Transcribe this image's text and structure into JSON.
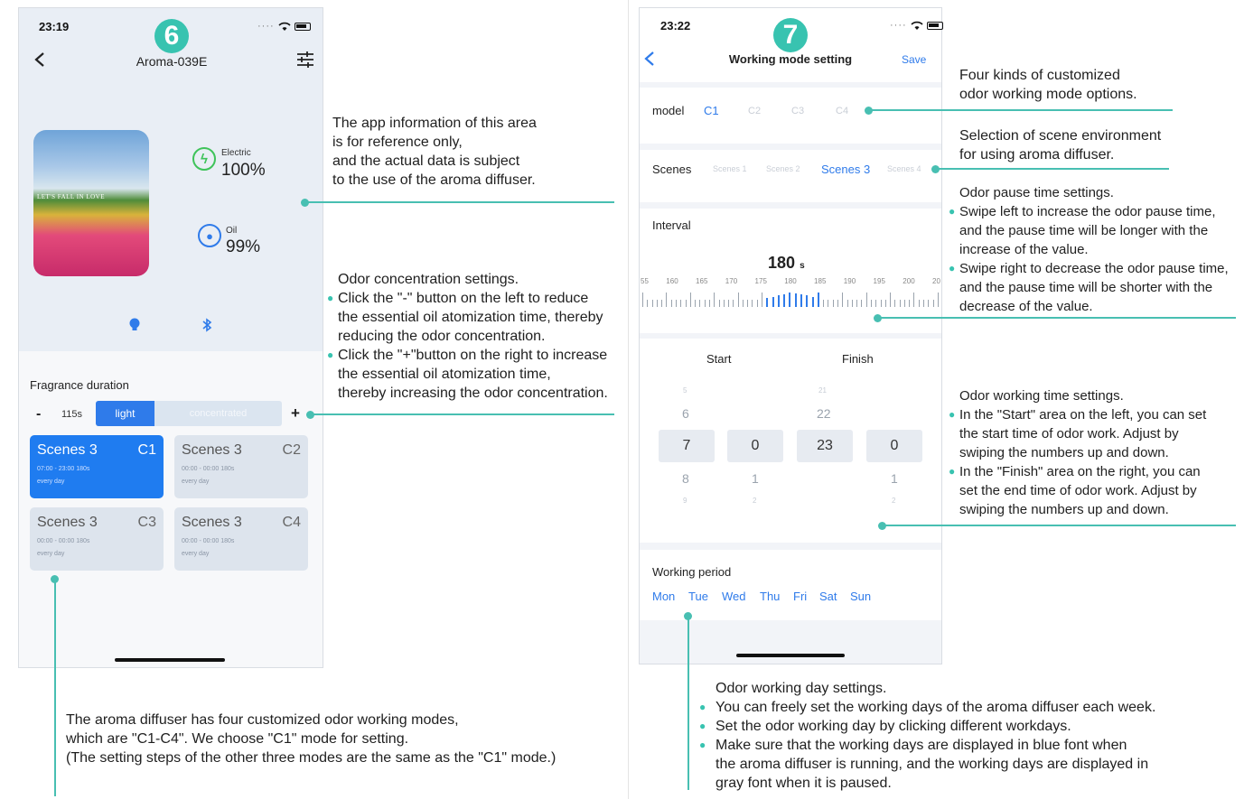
{
  "phone1": {
    "step": "6",
    "status_time": "23:19",
    "title": "Aroma-039E",
    "photo_text": "LET'S FALL IN LOVE",
    "electric_label": "Electric",
    "electric_value": "100%",
    "oil_label": "Oil",
    "oil_value": "99%",
    "fragrance_title": "Fragrance duration",
    "minus": "-",
    "duration_value": "115s",
    "seg_light": "light",
    "seg_concentrated": "concentrated",
    "plus": "+",
    "cards": [
      {
        "name": "Scenes 3",
        "code": "C1",
        "time": "07:00 - 23:00   180s",
        "days": "every day"
      },
      {
        "name": "Scenes 3",
        "code": "C2",
        "time": "00:00 - 00:00   180s",
        "days": "every day"
      },
      {
        "name": "Scenes 3",
        "code": "C3",
        "time": "00:00 - 00:00   180s",
        "days": "every day"
      },
      {
        "name": "Scenes 3",
        "code": "C4",
        "time": "00:00 - 00:00   180s",
        "days": "every day"
      }
    ]
  },
  "phone2": {
    "step": "7",
    "status_time": "23:22",
    "title": "Working mode setting",
    "save": "Save",
    "model_label": "model",
    "models": [
      "C1",
      "C2",
      "C3",
      "C4"
    ],
    "scenes_label": "Scenes",
    "scenes": [
      "Scenes 1",
      "Scenes 2",
      "Scenes 3",
      "Scenes 4"
    ],
    "interval_label": "Interval",
    "interval_value": "180",
    "interval_unit": "s",
    "ticks": [
      "55",
      "160",
      "165",
      "170",
      "175",
      "180",
      "185",
      "190",
      "195",
      "200",
      "20"
    ],
    "start_label": "Start",
    "finish_label": "Finish",
    "wheel": {
      "row_far_top": [
        "5",
        "21"
      ],
      "row_top": [
        "6",
        "22"
      ],
      "row_sel": [
        "7",
        "0",
        "23",
        "0"
      ],
      "row_bottom": [
        "8",
        "1",
        "1"
      ],
      "row_far_bottom": [
        "9",
        "2",
        "2"
      ]
    },
    "working_period_label": "Working period",
    "days": [
      "Mon",
      "Tue",
      "Wed",
      "Thu",
      "Fri",
      "Sat",
      "Sun"
    ]
  },
  "callouts": {
    "app_info": [
      "The app information of this area",
      "is for reference only,",
      "and the actual data is subject",
      "to the use of the aroma diffuser."
    ],
    "odor_conc_title": "Odor concentration settings.",
    "odor_conc_b1": [
      "Click the \"-\" button on the left to reduce",
      "the essential oil atomization time, thereby",
      "reducing the odor concentration."
    ],
    "odor_conc_b2": [
      "Click the \"+\"button on the right to increase",
      "the essential oil atomization time,",
      "thereby increasing the odor concentration."
    ],
    "modes": [
      "The aroma diffuser has four customized odor working modes,",
      "which are \"C1-C4\". We choose \"C1\" mode for setting.",
      "(The setting steps of the other three modes are the same as the \"C1\" mode.)"
    ],
    "four_kinds": [
      "Four kinds of customized",
      "odor working mode options."
    ],
    "scene_sel": [
      "Selection of scene environment",
      "for using aroma diffuser."
    ],
    "pause_title": "Odor pause time settings.",
    "pause_b1": [
      "Swipe left to increase the odor pause time,",
      "and the pause time will be longer with the",
      "increase of the value."
    ],
    "pause_b2": [
      "Swipe right to decrease the odor pause time,",
      "and the pause time will be shorter with the",
      "decrease of the value."
    ],
    "worktime_title": "Odor working time settings.",
    "worktime_b1": [
      "In the \"Start\" area on the left, you can set",
      "the start time of odor work. Adjust by",
      "swiping the numbers up and down."
    ],
    "worktime_b2": [
      "In the \"Finish\" area on the right, you can",
      "set the end time of odor work. Adjust by",
      "swiping the numbers up and down."
    ],
    "workday_title": "Odor working day settings.",
    "workday_b1": [
      "You can freely set the working days of the aroma diffuser each week."
    ],
    "workday_b2": [
      "Set the odor working day by clicking different workdays."
    ],
    "workday_b3": [
      "Make sure that the working days are displayed in blue font when",
      "the aroma diffuser is running, and the working days are displayed in",
      "gray font when it is paused."
    ]
  },
  "colors": {
    "accent": "#2f7bea",
    "teal": "#38c3b0"
  }
}
